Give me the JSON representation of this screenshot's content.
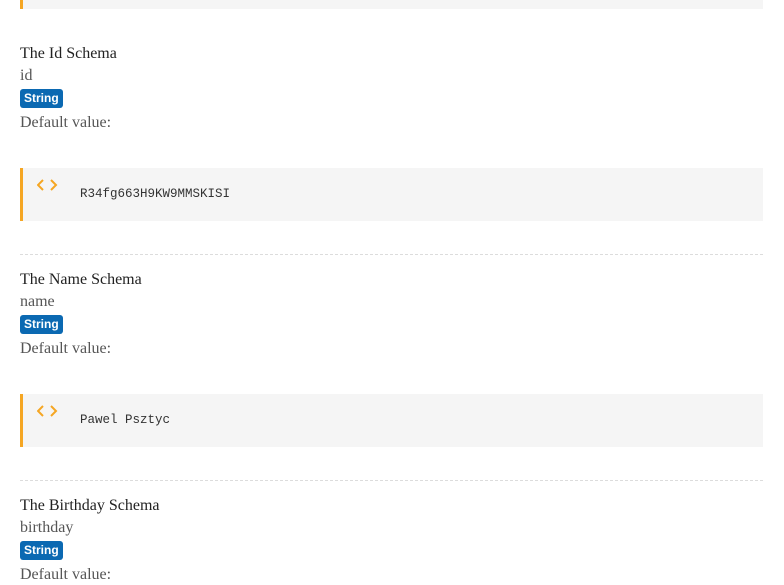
{
  "sections": [
    {
      "title": "The Id Schema",
      "key": "id",
      "type": "String",
      "default_label": "Default value:",
      "default_value": "R34fg663H9KW9MMSKISI"
    },
    {
      "title": "The Name Schema",
      "key": "name",
      "type": "String",
      "default_label": "Default value:",
      "default_value": "Pawel Psztyc"
    },
    {
      "title": "The Birthday Schema",
      "key": "birthday",
      "type": "String",
      "default_label": "Default value:"
    }
  ],
  "icons": {
    "code": "code-icon"
  },
  "colors": {
    "accent_border": "#f5a623",
    "badge_background": "#0b69b2",
    "code_background": "#f5f5f5"
  }
}
